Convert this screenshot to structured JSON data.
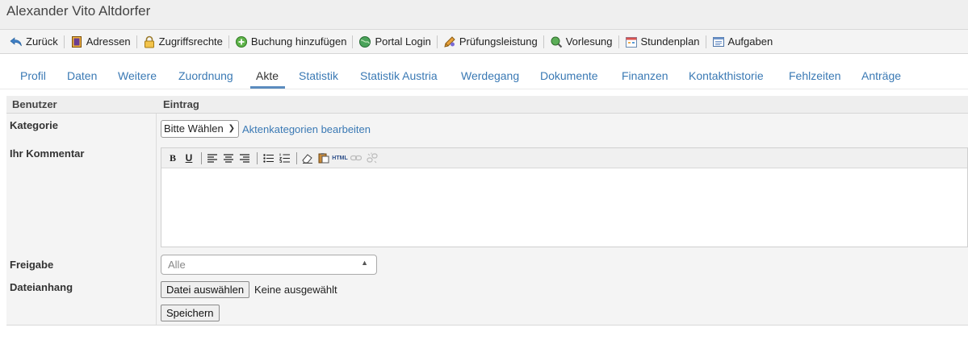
{
  "page_title": "Alexander Vito Altdorfer",
  "toolbar": {
    "items": [
      {
        "label": "Zurück",
        "icon": "back-arrow-icon"
      },
      {
        "label": "Adressen",
        "icon": "address-book-icon"
      },
      {
        "label": "Zugriffsrechte",
        "icon": "lock-icon"
      },
      {
        "label": "Buchung hinzufügen",
        "icon": "add-circle-icon"
      },
      {
        "label": "Portal Login",
        "icon": "globe-icon"
      },
      {
        "label": "Prüfungsleistung",
        "icon": "pencil-icon"
      },
      {
        "label": "Vorlesung",
        "icon": "magnifier-icon"
      },
      {
        "label": "Stundenplan",
        "icon": "calendar-icon"
      },
      {
        "label": "Aufgaben",
        "icon": "task-list-icon"
      }
    ]
  },
  "tabs": [
    {
      "label": "Profil"
    },
    {
      "label": "Daten"
    },
    {
      "label": "Weitere"
    },
    {
      "label": "Zuordnung"
    },
    {
      "label": "Akte",
      "active": true
    },
    {
      "label": "Statistik"
    },
    {
      "label": "Statistik Austria"
    },
    {
      "label": "Werdegang"
    },
    {
      "label": "Dokumente"
    },
    {
      "label": "Finanzen"
    },
    {
      "label": "Kontakthistorie"
    },
    {
      "label": "Fehlzeiten"
    },
    {
      "label": "Anträge"
    }
  ],
  "table": {
    "header_left": "Benutzer",
    "header_right": "Eintrag"
  },
  "form": {
    "kategorie_label": "Kategorie",
    "kategorie_value": "Bitte Wählen",
    "kategorie_link": "Aktenkategorien bearbeiten",
    "kommentar_label": "Ihr Kommentar",
    "editor_buttons": {
      "bold": "B",
      "underline": "U",
      "html": "HTML"
    },
    "freigabe_label": "Freigabe",
    "freigabe_value": "Alle",
    "dateianhang_label": "Dateianhang",
    "file_button": "Datei auswählen",
    "file_status": "Keine ausgewählt",
    "save_button": "Speichern"
  },
  "colors": {
    "link": "#3a79b4",
    "tab_underline": "#5b8cbf",
    "panel_bg": "#f4f4f4"
  }
}
